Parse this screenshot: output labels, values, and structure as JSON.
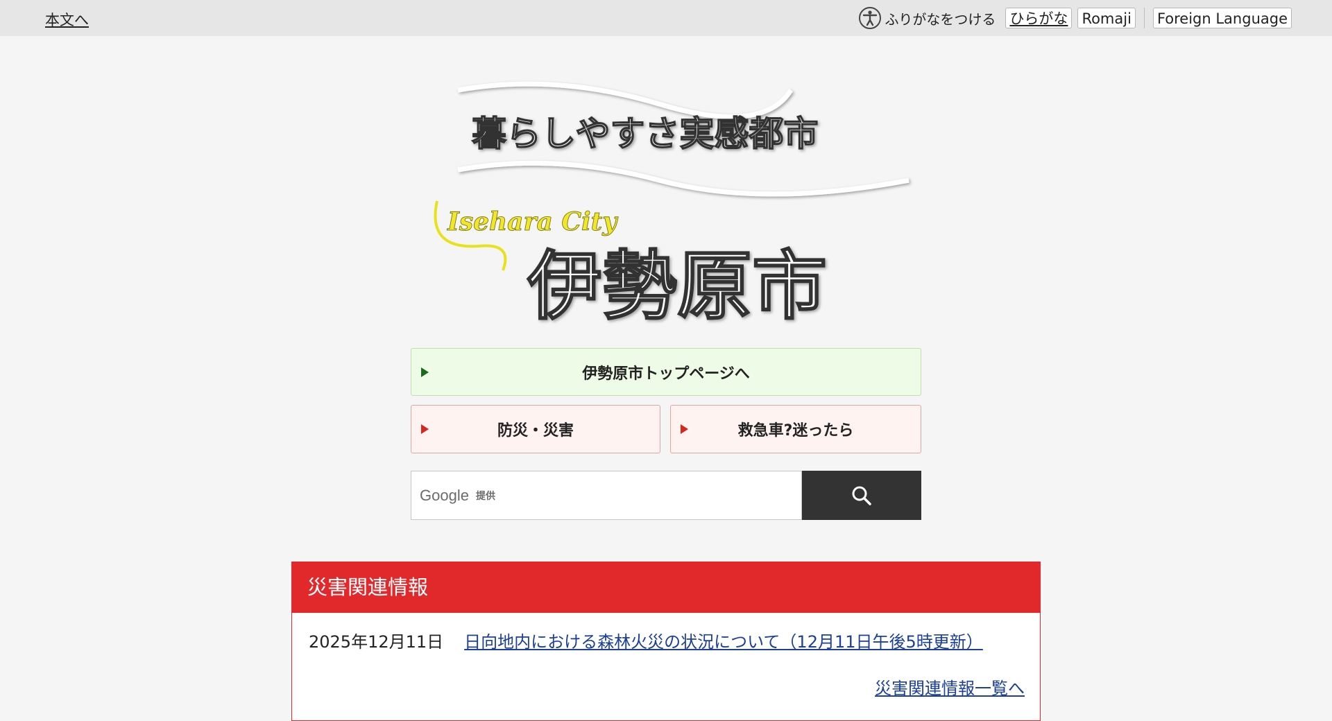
{
  "topbar": {
    "skip_link": "本文へ",
    "furigana_label": "ふりがなをつける",
    "hiragana_btn": "ひらがな",
    "romaji_btn": "Romaji",
    "foreign_btn": "Foreign Language"
  },
  "logo": {
    "tagline": "暮らしやすさ実感都市",
    "english": "Isehara City",
    "city": "伊勢原市"
  },
  "nav": {
    "top_page": "伊勢原市トップページへ",
    "bosai": "防災・災害",
    "kyukyu": "救急車?迷ったら"
  },
  "search": {
    "brand": "Google",
    "brand_sub": "提供",
    "icon": "search-icon"
  },
  "disaster": {
    "heading": "災害関連情報",
    "items": [
      {
        "date": "2025年12月11日",
        "title": "日向地内における森林火災の状況について（12月11日午後5時更新）"
      }
    ],
    "more_link": "災害関連情報一覧へ"
  },
  "colors": {
    "accent_red": "#e1282b",
    "link_blue": "#1b3f9c",
    "green_bg": "#eefbe6",
    "pink_bg": "#fff3f1"
  }
}
